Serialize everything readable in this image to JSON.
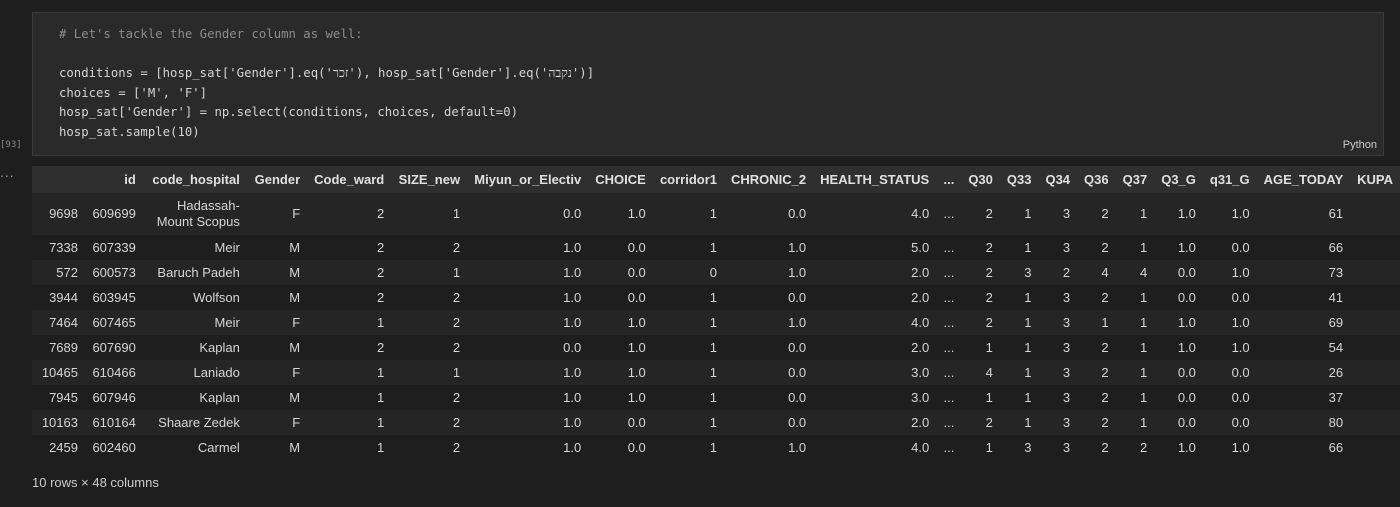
{
  "cell": {
    "exec_count": "[93]",
    "output_prompt": "...",
    "language": "Python",
    "code_lines": [
      "# Let's tackle the Gender column as well:",
      "",
      "conditions = [hosp_sat['Gender'].eq('זכר'), hosp_sat['Gender'].eq('נקבה')]",
      "choices = ['M', 'F']",
      "hosp_sat['Gender'] = np.select(conditions, choices, default=0)",
      "hosp_sat.sample(10)"
    ]
  },
  "table": {
    "columns": [
      "",
      "id",
      "code_hospital",
      "Gender",
      "Code_ward",
      "SIZE_new",
      "Miyun_or_Electiv",
      "CHOICE",
      "corridor1",
      "CHRONIC_2",
      "HEALTH_STATUS",
      "...",
      "Q30",
      "Q33",
      "Q34",
      "Q36",
      "Q37",
      "Q3_G",
      "q31_G",
      "AGE_TODAY",
      "KUPA"
    ],
    "rows": [
      [
        "9698",
        "609699",
        "Hadassah-Mount Scopus",
        "F",
        "2",
        "1",
        "0.0",
        "1.0",
        "1",
        "0.0",
        "4.0",
        "...",
        "2",
        "1",
        "3",
        "2",
        "1",
        "1.0",
        "1.0",
        "61",
        ""
      ],
      [
        "7338",
        "607339",
        "Meir",
        "M",
        "2",
        "2",
        "1.0",
        "0.0",
        "1",
        "1.0",
        "5.0",
        "...",
        "2",
        "1",
        "3",
        "2",
        "1",
        "1.0",
        "0.0",
        "66",
        ""
      ],
      [
        "572",
        "600573",
        "Baruch Padeh",
        "M",
        "2",
        "1",
        "1.0",
        "0.0",
        "0",
        "1.0",
        "2.0",
        "...",
        "2",
        "3",
        "2",
        "4",
        "4",
        "0.0",
        "1.0",
        "73",
        ""
      ],
      [
        "3944",
        "603945",
        "Wolfson",
        "M",
        "2",
        "2",
        "1.0",
        "0.0",
        "1",
        "0.0",
        "2.0",
        "...",
        "2",
        "1",
        "3",
        "2",
        "1",
        "0.0",
        "0.0",
        "41",
        ""
      ],
      [
        "7464",
        "607465",
        "Meir",
        "F",
        "1",
        "2",
        "1.0",
        "1.0",
        "1",
        "1.0",
        "4.0",
        "...",
        "2",
        "1",
        "3",
        "1",
        "1",
        "1.0",
        "1.0",
        "69",
        ""
      ],
      [
        "7689",
        "607690",
        "Kaplan",
        "M",
        "2",
        "2",
        "0.0",
        "1.0",
        "1",
        "0.0",
        "2.0",
        "...",
        "1",
        "1",
        "3",
        "2",
        "1",
        "1.0",
        "1.0",
        "54",
        ""
      ],
      [
        "10465",
        "610466",
        "Laniado",
        "F",
        "1",
        "1",
        "1.0",
        "1.0",
        "1",
        "0.0",
        "3.0",
        "...",
        "4",
        "1",
        "3",
        "2",
        "1",
        "0.0",
        "0.0",
        "26",
        ""
      ],
      [
        "7945",
        "607946",
        "Kaplan",
        "M",
        "1",
        "2",
        "1.0",
        "1.0",
        "1",
        "0.0",
        "3.0",
        "...",
        "1",
        "1",
        "3",
        "2",
        "1",
        "0.0",
        "0.0",
        "37",
        ""
      ],
      [
        "10163",
        "610164",
        "Shaare Zedek",
        "F",
        "1",
        "2",
        "1.0",
        "0.0",
        "1",
        "0.0",
        "2.0",
        "...",
        "2",
        "1",
        "3",
        "2",
        "1",
        "0.0",
        "0.0",
        "80",
        ""
      ],
      [
        "2459",
        "602460",
        "Carmel",
        "M",
        "1",
        "2",
        "1.0",
        "0.0",
        "1",
        "1.0",
        "4.0",
        "...",
        "1",
        "3",
        "3",
        "2",
        "2",
        "1.0",
        "1.0",
        "66",
        ""
      ]
    ],
    "footer": "10 rows × 48 columns"
  }
}
